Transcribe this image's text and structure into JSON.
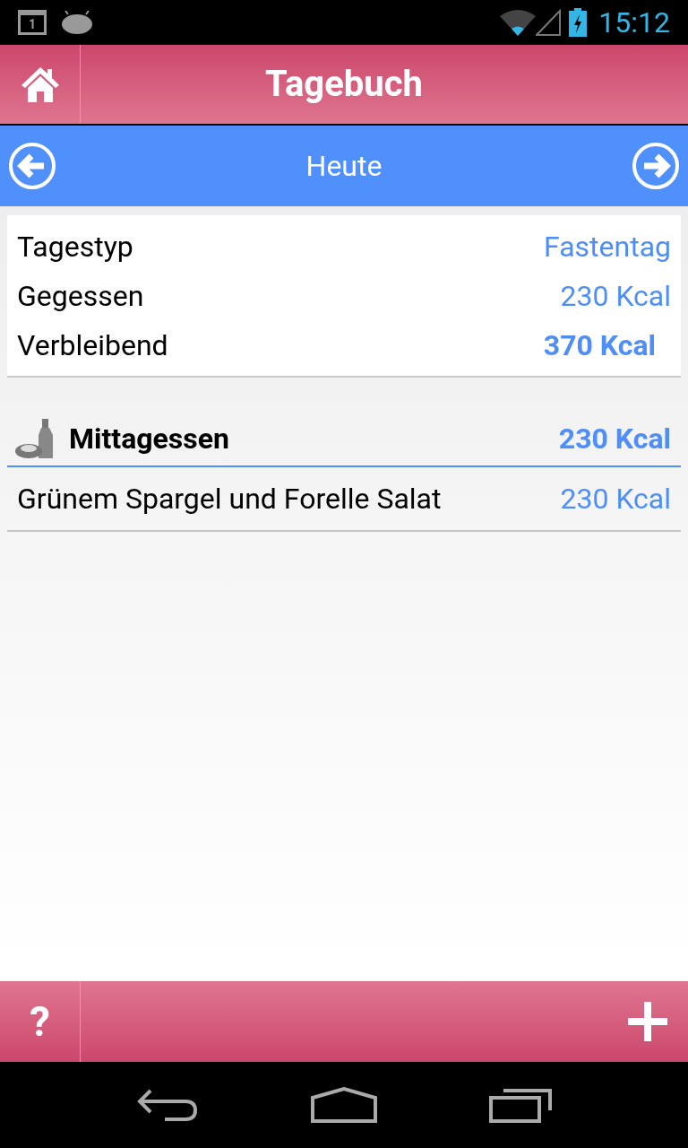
{
  "status_bar": {
    "calendar_day": "1",
    "time": "15:12"
  },
  "header": {
    "title": "Tagebuch"
  },
  "date_nav": {
    "label": "Heute"
  },
  "summary": [
    {
      "label": "Tagestyp",
      "value": "Fastentag",
      "emphasized": false
    },
    {
      "label": "Gegessen",
      "value": "230 Kcal",
      "emphasized": false
    },
    {
      "label": "Verbleibend",
      "value": "370 Kcal",
      "emphasized": true
    }
  ],
  "meals": [
    {
      "name": "Mittagessen",
      "kcal": "230 Kcal",
      "items": [
        {
          "name": "Grünem Spargel und Forelle Salat",
          "kcal": "230 Kcal"
        }
      ]
    }
  ],
  "footer": {
    "help": "?"
  }
}
